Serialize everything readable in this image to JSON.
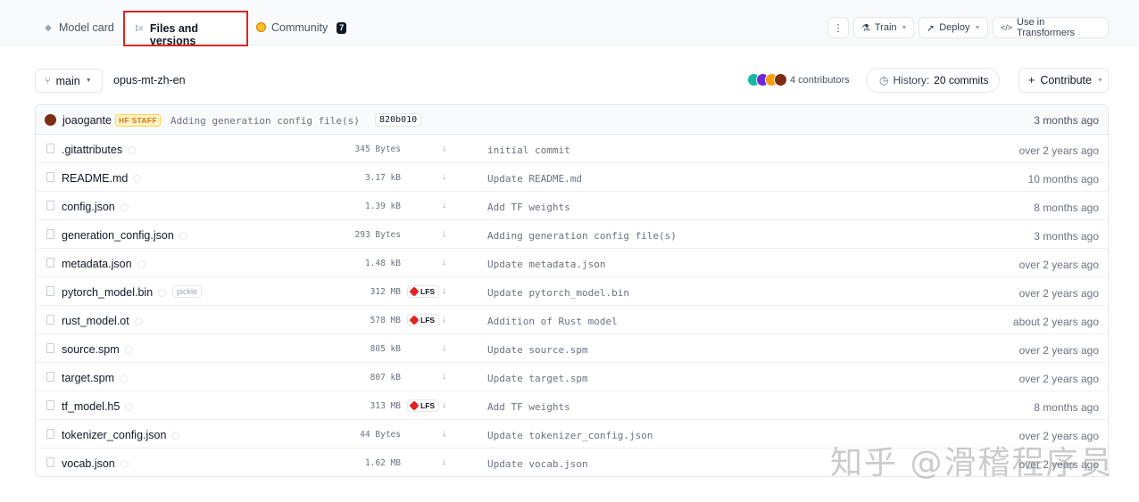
{
  "tabs": {
    "model_card": "Model card",
    "files": "Files and versions",
    "community": "Community",
    "community_count": "7"
  },
  "toolbar": {
    "more": "⋮",
    "train": "Train",
    "deploy": "Deploy",
    "transformers": "Use in Transformers"
  },
  "repo": {
    "branch": "main",
    "name": "opus-mt-zh-en",
    "contributors": "4 contributors",
    "history_prefix": "History:",
    "history_commits": "20 commits",
    "contribute": "Contribute"
  },
  "last_commit": {
    "user": "joaogante",
    "badge": "HF STAFF",
    "message": "Adding generation config file(s)",
    "hash": "820b010",
    "time": "3 months ago"
  },
  "files": [
    {
      "name": ".gitattributes",
      "size": "345 Bytes",
      "lfs": false,
      "message": "initial commit",
      "time": "over 2 years ago"
    },
    {
      "name": "README.md",
      "size": "3.17 kB",
      "lfs": false,
      "message": "Update README.md",
      "time": "10 months ago"
    },
    {
      "name": "config.json",
      "size": "1.39 kB",
      "lfs": false,
      "message": "Add TF weights",
      "time": "8 months ago"
    },
    {
      "name": "generation_config.json",
      "size": "293 Bytes",
      "lfs": false,
      "message": "Adding generation config file(s)",
      "time": "3 months ago"
    },
    {
      "name": "metadata.json",
      "size": "1.48 kB",
      "lfs": false,
      "message": "Update metadata.json",
      "time": "over 2 years ago"
    },
    {
      "name": "pytorch_model.bin",
      "size": "312 MB",
      "lfs": true,
      "tag": "pickle",
      "message": "Update pytorch_model.bin",
      "time": "over 2 years ago"
    },
    {
      "name": "rust_model.ot",
      "size": "578 MB",
      "lfs": true,
      "message": "Addition of Rust model",
      "time": "about 2 years ago"
    },
    {
      "name": "source.spm",
      "size": "805 kB",
      "lfs": false,
      "message": "Update source.spm",
      "time": "over 2 years ago"
    },
    {
      "name": "target.spm",
      "size": "807 kB",
      "lfs": false,
      "message": "Update target.spm",
      "time": "over 2 years ago"
    },
    {
      "name": "tf_model.h5",
      "size": "313 MB",
      "lfs": true,
      "message": "Add TF weights",
      "time": "8 months ago"
    },
    {
      "name": "tokenizer_config.json",
      "size": "44 Bytes",
      "lfs": false,
      "message": "Update tokenizer_config.json",
      "time": "over 2 years ago"
    },
    {
      "name": "vocab.json",
      "size": "1.62 MB",
      "lfs": false,
      "message": "Update vocab.json",
      "time": "over 2 years ago"
    }
  ],
  "lfs_label": "LFS",
  "download_glyph": "↓",
  "watermark": "知乎 @滑稽程序员",
  "colors": {
    "highlight": "#dc2626",
    "avatars": [
      "#14b8a6",
      "#6d28d9",
      "#f59e0b",
      "#7c2d12"
    ]
  }
}
